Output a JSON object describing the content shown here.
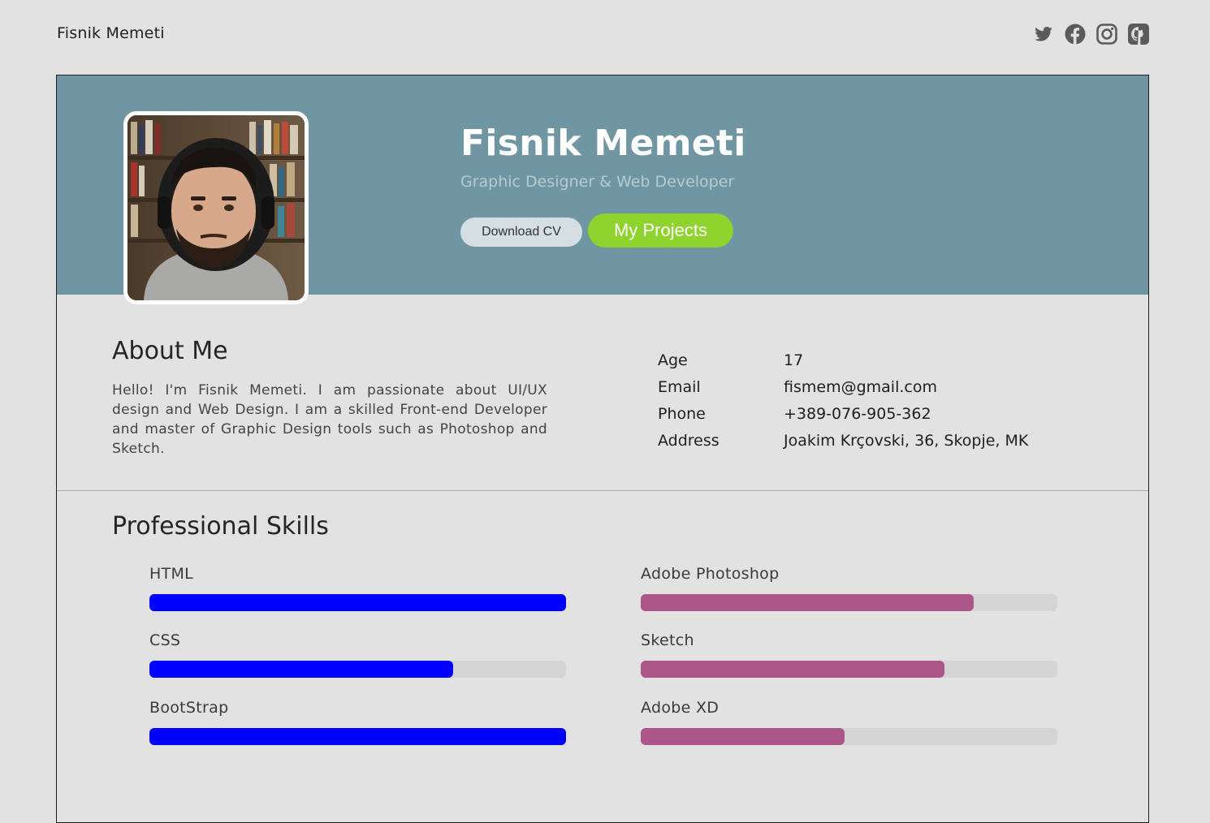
{
  "header": {
    "brand": "Fisnik Memeti",
    "social_icons": [
      "twitter-icon",
      "facebook-icon",
      "instagram-icon",
      "github-icon"
    ]
  },
  "hero": {
    "name": "Fisnik Memeti",
    "subtitle": "Graphic Designer & Web Developer",
    "download_cv_label": "Download CV",
    "projects_label": "My Projects",
    "colors": {
      "banner": "#7196a3",
      "projects_button": "#8fd42e"
    }
  },
  "about": {
    "title": "About Me",
    "text": "Hello! I'm Fisnik Memeti. I am passionate about UI/UX design and Web Design. I am a skilled Front-end Developer and master of Graphic Design tools such as Photoshop and Sketch.",
    "info": [
      {
        "label": "Age",
        "value": "17"
      },
      {
        "label": "Email",
        "value": "fismem@gmail.com"
      },
      {
        "label": "Phone",
        "value": "+389-076-905-362"
      },
      {
        "label": "Address",
        "value": "Joakim Krçovski, 36, Skopje, MK"
      }
    ]
  },
  "skills": {
    "title": "Professional Skills",
    "colors": {
      "dev": "#0000ff",
      "design": "#ac568a",
      "track": "#d4d4d4"
    },
    "items": [
      {
        "name": "HTML",
        "level": 1.0,
        "group": "dev"
      },
      {
        "name": "CSS",
        "level": 0.73,
        "group": "dev"
      },
      {
        "name": "BootStrap",
        "level": 1.0,
        "group": "dev"
      },
      {
        "name": "Adobe Photoshop",
        "level": 0.8,
        "group": "design"
      },
      {
        "name": "Sketch",
        "level": 0.73,
        "group": "design"
      },
      {
        "name": "Adobe XD",
        "level": 0.49,
        "group": "design"
      }
    ]
  }
}
